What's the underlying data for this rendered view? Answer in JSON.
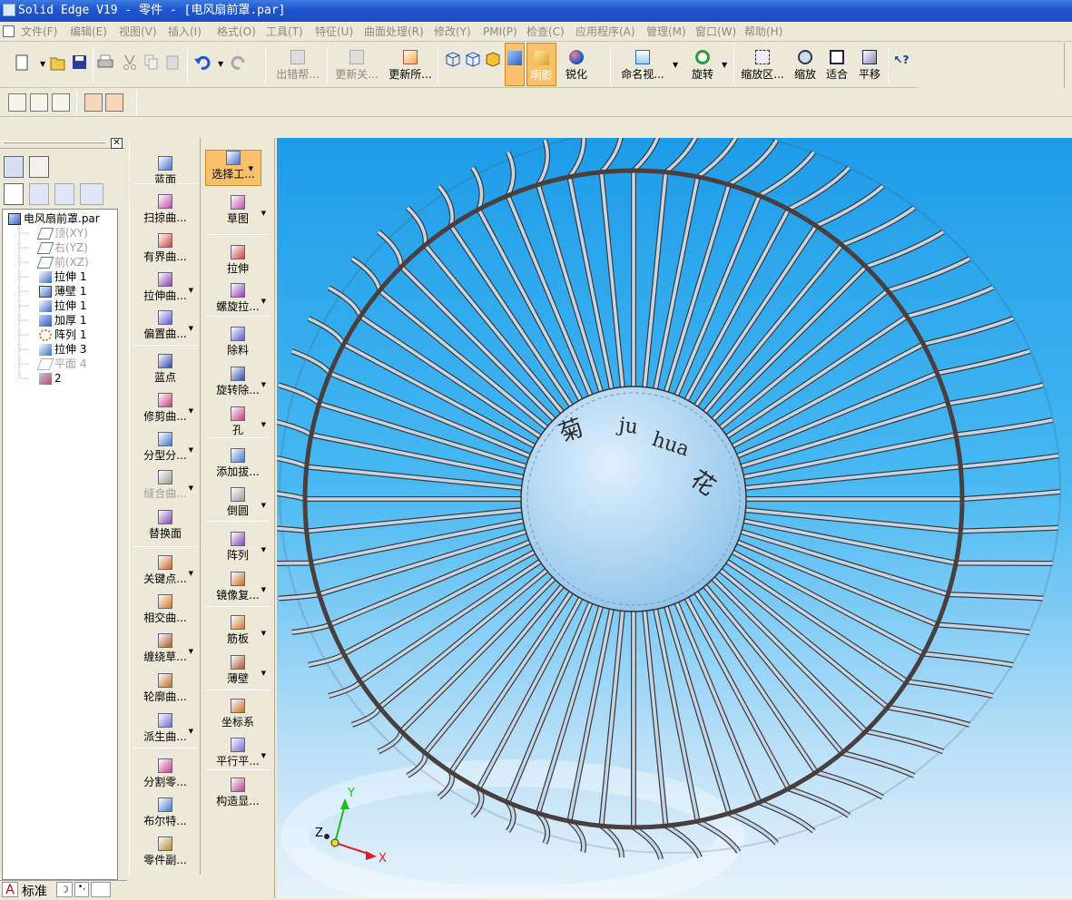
{
  "window": {
    "title": "Solid Edge V19 - 零件 - [电风扇前罩.par]"
  },
  "menu": [
    "文件(F)",
    "编辑(E)",
    "视图(V)",
    "插入(I)",
    "格式(O)",
    "工具(T)",
    "特征(U)",
    "曲面处理(R)",
    "修改(Y)",
    "PMI(P)",
    "检查(C)",
    "应用程序(A)",
    "管理(M)",
    "窗口(W)",
    "帮助(H)"
  ],
  "toolbar": {
    "error_help": "出错帮...",
    "update_related": "更新关...",
    "update_all": "更新所...",
    "shaded": "明影",
    "sharpen": "锐化",
    "named_views": "命名视...",
    "rotate": "旋转",
    "zoom_area": "缩放区...",
    "zoom": "缩放",
    "fit": "适合",
    "pan": "平移"
  },
  "tree": {
    "root": "电风扇前罩.par",
    "items": [
      {
        "label": "顶(XY)",
        "dim": true
      },
      {
        "label": "右(YZ)",
        "dim": true
      },
      {
        "label": "前(XZ)",
        "dim": true
      },
      {
        "label": "拉伸 1",
        "dim": false
      },
      {
        "label": "薄壁 1",
        "dim": false
      },
      {
        "label": "拉伸 1",
        "dim": false
      },
      {
        "label": "加厚 1",
        "dim": false
      },
      {
        "label": "阵列 1",
        "dim": false
      },
      {
        "label": "拉伸 3",
        "dim": false
      },
      {
        "label": "平面 4",
        "dim": true
      },
      {
        "label": "2",
        "dim": false
      }
    ]
  },
  "surfacing_tools": [
    "蓝面",
    "扫掠曲...",
    "有界曲...",
    "拉伸曲...",
    "偏置曲...",
    "蓝点",
    "修剪曲...",
    "分型分...",
    "缝合曲...",
    "替换面",
    "关键点...",
    "相交曲...",
    "缠绕草...",
    "轮廓曲...",
    "派生曲...",
    "分割零...",
    "布尔特...",
    "零件副..."
  ],
  "feature_tools": [
    "选择工...",
    "草图",
    "拉伸",
    "螺旋拉...",
    "除料",
    "旋转除...",
    "孔",
    "添加拔...",
    "倒圆",
    "阵列",
    "镜像复...",
    "筋板",
    "薄壁",
    "坐标系",
    "平行平...",
    "构造显..."
  ],
  "viewport": {
    "text_chars": [
      "菊",
      "ju",
      "hua",
      "花"
    ],
    "axes": [
      "X",
      "Y",
      "Z"
    ]
  },
  "status": {
    "lang": "标准"
  }
}
